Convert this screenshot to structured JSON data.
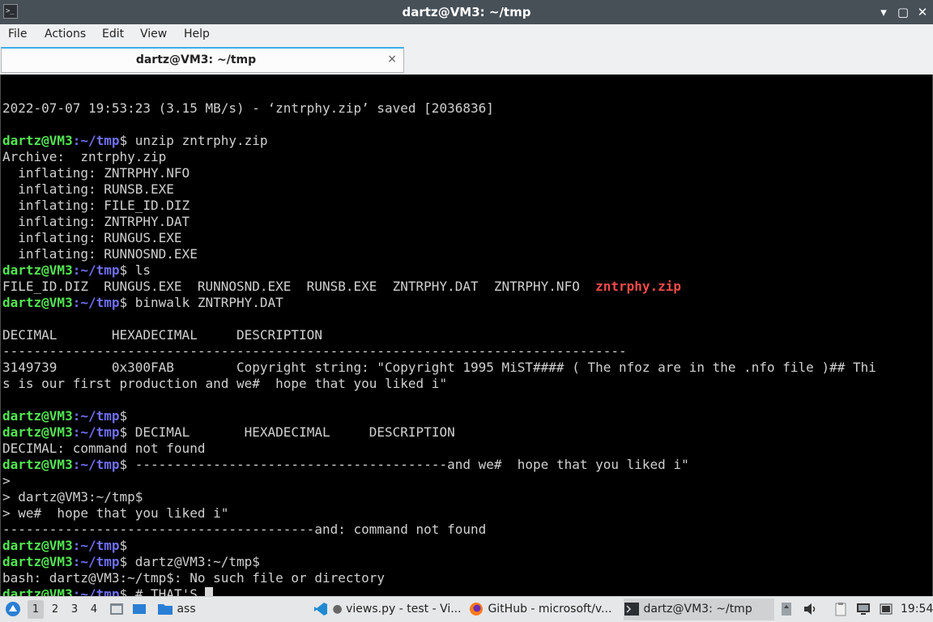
{
  "window": {
    "title": "dartz@VM3: ~/tmp",
    "minimize_glyph": "▾",
    "maximize_glyph": "▢",
    "close_glyph": "✕",
    "app_icon": "terminal-icon"
  },
  "menu": [
    "File",
    "Actions",
    "Edit",
    "View",
    "Help"
  ],
  "tab": {
    "label": "dartz@VM3: ~/tmp",
    "close_glyph": "×"
  },
  "prompt": {
    "user": "dartz@VM3",
    "path": ":~/tmp",
    "symbol": "$"
  },
  "terminal": {
    "lines": [
      {
        "type": "text",
        "text": ""
      },
      {
        "type": "text",
        "text": "2022-07-07 19:53:23 (3.15 MB/s) - ‘zntrphy.zip’ saved [2036836]"
      },
      {
        "type": "text",
        "text": ""
      },
      {
        "type": "prompt",
        "cmd": " unzip zntrphy.zip"
      },
      {
        "type": "text",
        "text": "Archive:  zntrphy.zip"
      },
      {
        "type": "text",
        "text": "  inflating: ZNTRPHY.NFO"
      },
      {
        "type": "text",
        "text": "  inflating: RUNSB.EXE"
      },
      {
        "type": "text",
        "text": "  inflating: FILE_ID.DIZ"
      },
      {
        "type": "text",
        "text": "  inflating: ZNTRPHY.DAT"
      },
      {
        "type": "text",
        "text": "  inflating: RUNGUS.EXE"
      },
      {
        "type": "text",
        "text": "  inflating: RUNNOSND.EXE"
      },
      {
        "type": "prompt",
        "cmd": " ls"
      },
      {
        "type": "ls",
        "text": "FILE_ID.DIZ  RUNGUS.EXE  RUNNOSND.EXE  RUNSB.EXE  ZNTRPHY.DAT  ZNTRPHY.NFO  ",
        "highlight": "zntrphy.zip"
      },
      {
        "type": "prompt",
        "cmd": " binwalk ZNTRPHY.DAT"
      },
      {
        "type": "text",
        "text": ""
      },
      {
        "type": "text",
        "text": "DECIMAL       HEXADECIMAL     DESCRIPTION"
      },
      {
        "type": "text",
        "text": "--------------------------------------------------------------------------------"
      },
      {
        "type": "text",
        "text": "3149739       0x300FAB        Copyright string: \"Copyright 1995 MiST#### ( The nfoz are in the .nfo file )## Thi"
      },
      {
        "type": "text",
        "text": "s is our first production and we#  hope that you liked i\""
      },
      {
        "type": "text",
        "text": ""
      },
      {
        "type": "prompt",
        "cmd": ""
      },
      {
        "type": "prompt",
        "cmd": " DECIMAL       HEXADECIMAL     DESCRIPTION"
      },
      {
        "type": "text",
        "text": "DECIMAL: command not found"
      },
      {
        "type": "prompt",
        "cmd": " ----------------------------------------and we#  hope that you liked i\""
      },
      {
        "type": "text",
        "text": ">"
      },
      {
        "type": "text",
        "text": "> dartz@VM3:~/tmp$"
      },
      {
        "type": "text",
        "text": "> we#  hope that you liked i\""
      },
      {
        "type": "text",
        "text": "----------------------------------------and: command not found"
      },
      {
        "type": "prompt",
        "cmd": ""
      },
      {
        "type": "prompt",
        "cmd": " dartz@VM3:~/tmp$"
      },
      {
        "type": "text",
        "text": "bash: dartz@VM3:~/tmp$: No such file or directory"
      },
      {
        "type": "prompt",
        "cmd": " # THAT'S ",
        "cursor": true
      }
    ]
  },
  "taskbar": {
    "workspaces": [
      "1",
      "2",
      "3",
      "4"
    ],
    "folder_label": "ass",
    "tasks": [
      {
        "label": "views.py - test - Vi...",
        "icon": "vscode-icon"
      },
      {
        "label": "GitHub - microsoft/v...",
        "icon": "firefox-icon"
      },
      {
        "label": "dartz@VM3: ~/tmp",
        "icon": "terminal-icon"
      }
    ],
    "clock": "19:54"
  },
  "colors": {
    "prompt_user": "#54e454",
    "prompt_path": "#6f6ff3",
    "zip_highlight": "#f04a4a",
    "accent": "#3daee9"
  }
}
